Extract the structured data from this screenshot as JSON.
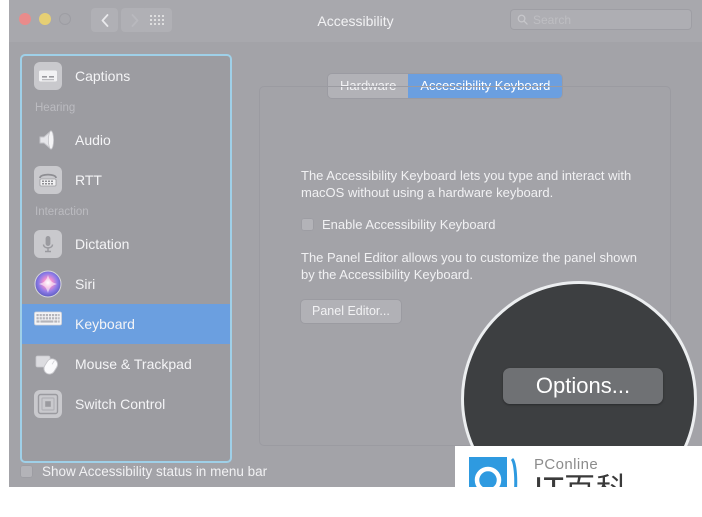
{
  "window": {
    "title": "Accessibility",
    "traffic_lights": [
      "close",
      "minimize",
      "zoom"
    ],
    "nav": {
      "back_label": "Back",
      "forward_label": "Forward",
      "grid_label": "Show All"
    },
    "search": {
      "placeholder": "Search",
      "value": ""
    }
  },
  "sidebar": {
    "items": [
      {
        "label": "Captions",
        "icon": "captions-icon",
        "type": "item",
        "selected": false
      },
      {
        "label": "Hearing",
        "icon": "",
        "type": "header",
        "selected": false
      },
      {
        "label": "Audio",
        "icon": "audio-speaker-icon",
        "type": "item",
        "selected": false
      },
      {
        "label": "RTT",
        "icon": "rtt-telephone-icon",
        "type": "item",
        "selected": false
      },
      {
        "label": "Interaction",
        "icon": "",
        "type": "header",
        "selected": false
      },
      {
        "label": "Dictation",
        "icon": "microphone-icon",
        "type": "item",
        "selected": false
      },
      {
        "label": "Siri",
        "icon": "siri-orb-icon",
        "type": "item",
        "selected": false
      },
      {
        "label": "Keyboard",
        "icon": "keyboard-icon",
        "type": "item",
        "selected": true
      },
      {
        "label": "Mouse & Trackpad",
        "icon": "mouse-trackpad-icon",
        "type": "item",
        "selected": false
      },
      {
        "label": "Switch Control",
        "icon": "switch-control-icon",
        "type": "item",
        "selected": false
      }
    ]
  },
  "main": {
    "tabs": [
      {
        "label": "Hardware",
        "active": false
      },
      {
        "label": "Accessibility Keyboard",
        "active": true
      }
    ],
    "description_1": "The Accessibility Keyboard lets you type and interact with macOS without using a hardware keyboard.",
    "enable_checkbox": {
      "label": "Enable Accessibility Keyboard",
      "checked": false
    },
    "description_2": "The Panel Editor allows you to customize the panel shown by the Accessibility Keyboard.",
    "panel_editor_button": "Panel Editor...",
    "options_button": "Options..."
  },
  "footer": {
    "status_checkbox": {
      "label": "Show Accessibility status in menu bar",
      "checked": false
    }
  },
  "watermark": {
    "brand": "PConline",
    "title_cn": "IT百科"
  },
  "colors": {
    "window_bg": "#a3a3a8",
    "toolbar_bg": "#a8a8ad",
    "accent_blue": "#6b9fe0",
    "sidebar_outline": "#9fd0e8",
    "magnifier_bg": "#3d3f41",
    "watermark_blue": "#2e9ae0"
  }
}
